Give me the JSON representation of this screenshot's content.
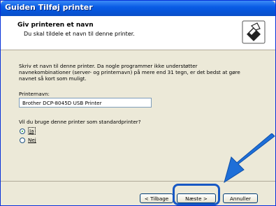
{
  "window": {
    "title": "Guiden Tilføj printer"
  },
  "header": {
    "title": "Giv printeren et navn",
    "subtitle": "Du skal tildele et navn til denne printer."
  },
  "content": {
    "instructions": "Skriv et navn til denne printer. Da nogle programmer ikke understøtter navnekombinationer (server- og printernavn) på mere end 31 tegn, er det bedst at gøre navnet så kort som muligt.",
    "printer_name_label": "Printernavn:",
    "printer_name_value": "Brother DCP-8045D USB Printer",
    "default_question": "Vil du bruge denne printer som standardprinter?",
    "radio_yes": "Ja",
    "radio_no": "Nej",
    "selected": "Ja"
  },
  "buttons": {
    "back": "< Tilbage",
    "next": "Næste >",
    "cancel": "Annuller"
  },
  "colors": {
    "titlebar": "#0a5de6",
    "highlight": "#1758c4",
    "arrow": "#1e6fd8"
  },
  "icons": [
    "printer-icon",
    "pointer-arrow-icon"
  ]
}
